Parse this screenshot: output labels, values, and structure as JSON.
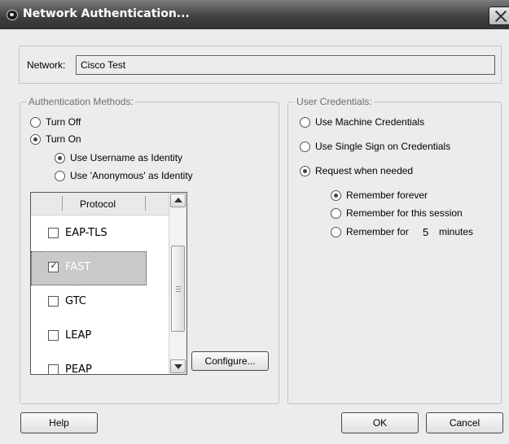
{
  "window": {
    "title": "Network Authentication..."
  },
  "network": {
    "label": "Network:",
    "value": "Cisco Test"
  },
  "auth_methods": {
    "legend": "Authentication Methods:",
    "turn_off": "Turn Off",
    "turn_on": "Turn On",
    "selected_power": "Turn On",
    "identity_username": "Use Username as Identity",
    "identity_anonymous": "Use 'Anonymous' as Identity",
    "selected_identity": "Use Username as Identity",
    "protocol_header": "Protocol",
    "protocols": [
      {
        "label": "EAP-TLS",
        "checked": false,
        "selected": false
      },
      {
        "label": "FAST",
        "checked": true,
        "selected": true
      },
      {
        "label": "GTC",
        "checked": false,
        "selected": false
      },
      {
        "label": "LEAP",
        "checked": false,
        "selected": false
      },
      {
        "label": "PEAP",
        "checked": false,
        "selected": false
      }
    ],
    "configure_label": "Configure..."
  },
  "credentials": {
    "legend": "User Credentials:",
    "machine": "Use Machine Credentials",
    "single_sign_on": "Use Single Sign on Credentials",
    "request": "Request when needed",
    "selected": "Request when needed",
    "remember_forever": "Remember forever",
    "remember_session": "Remember for this session",
    "remember_for_prefix": "Remember for",
    "remember_minutes_value": "5",
    "remember_minutes_unit": "minutes",
    "selected_remember": "Remember forever"
  },
  "buttons": {
    "help": "Help",
    "ok": "OK",
    "cancel": "Cancel"
  }
}
